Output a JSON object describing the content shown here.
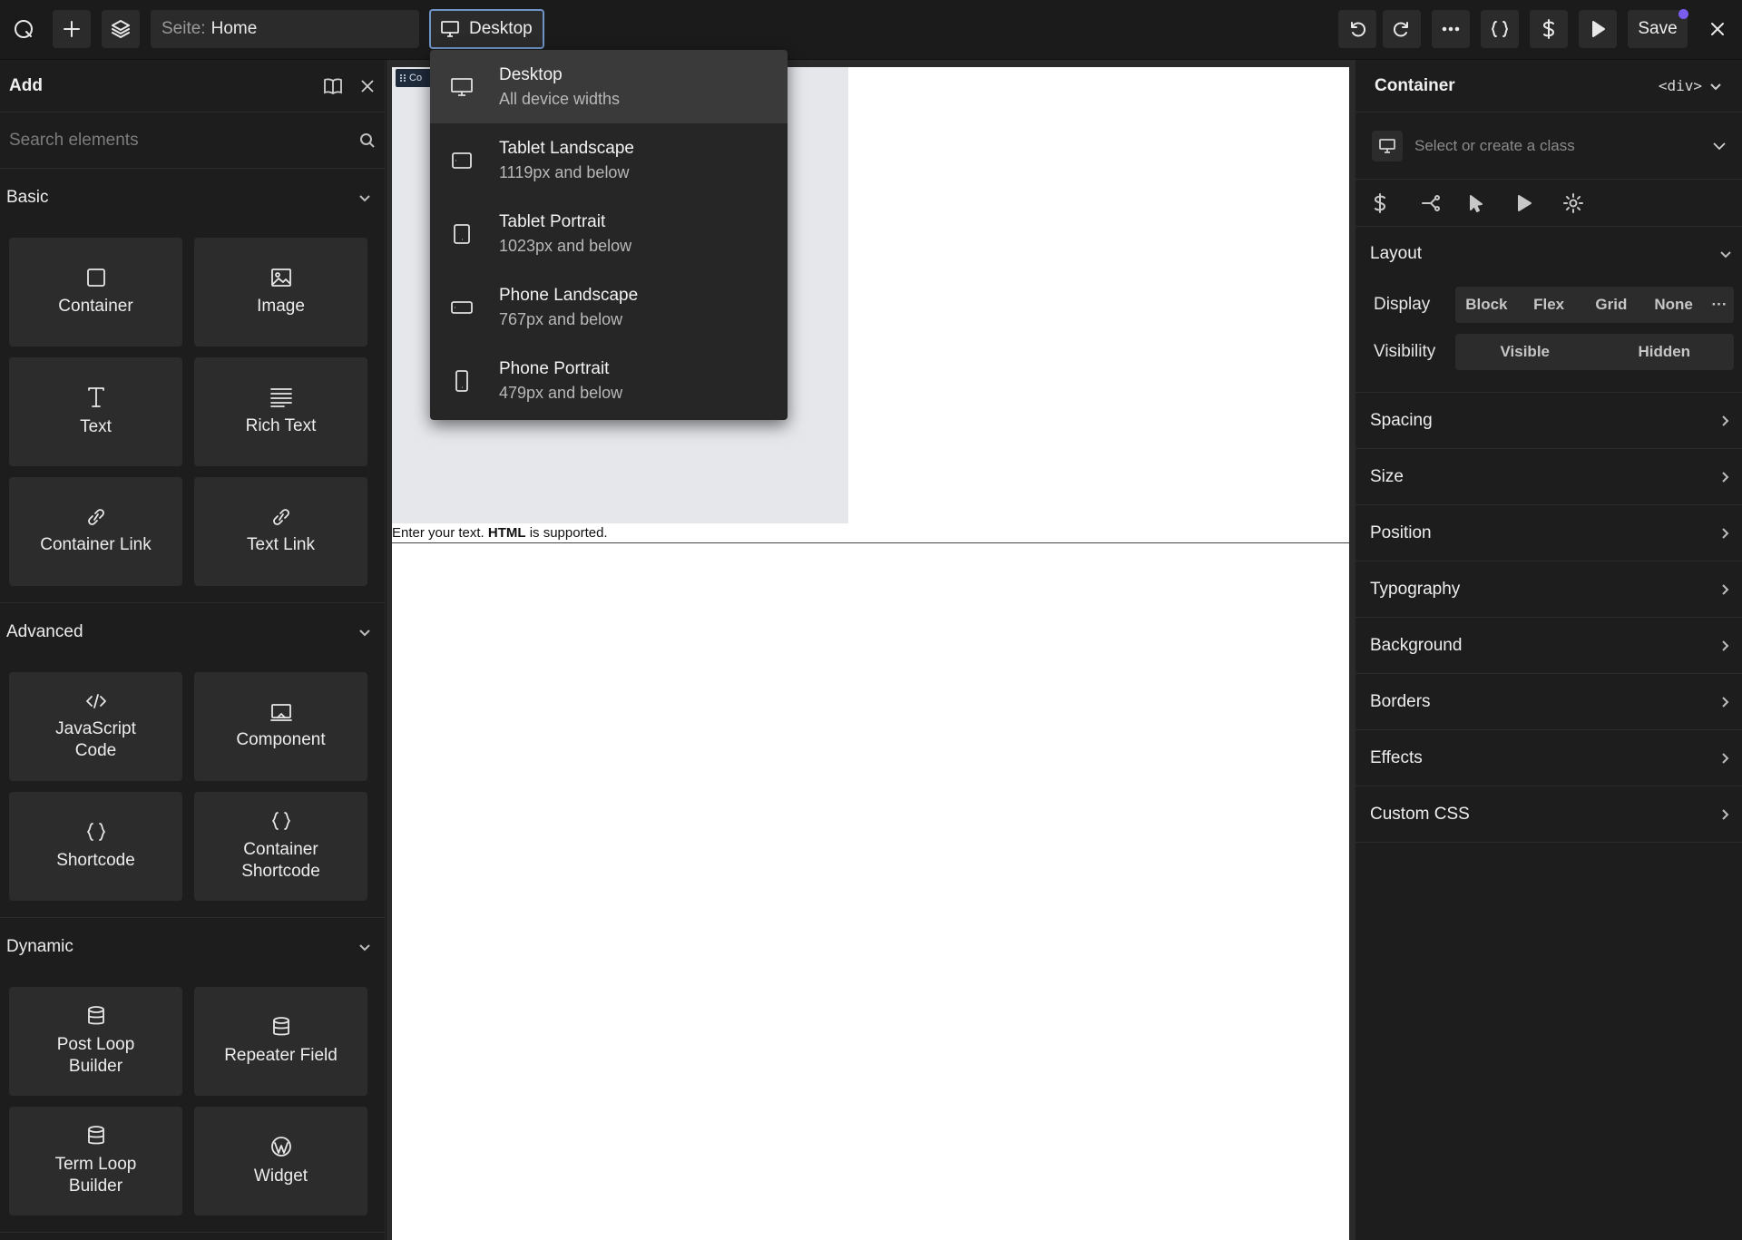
{
  "toolbar": {
    "page_prefix": "Seite:",
    "page_value": "Home",
    "device_label": "Desktop",
    "save_label": "Save"
  },
  "add_panel": {
    "title": "Add",
    "search_placeholder": "Search elements",
    "sections": [
      {
        "name": "Basic",
        "items": [
          "Container",
          "Image",
          "Text",
          "Rich Text",
          "Container Link",
          "Text Link"
        ]
      },
      {
        "name": "Advanced",
        "items": [
          "JavaScript Code",
          "Component",
          "Shortcode",
          "Container Shortcode"
        ]
      },
      {
        "name": "Dynamic",
        "items": [
          "Post Loop Builder",
          "Repeater Field",
          "Term Loop Builder",
          "Widget"
        ]
      }
    ]
  },
  "canvas": {
    "selected_tag": "Co",
    "text_before": "Enter your text. ",
    "text_bold": "HTML",
    "text_after": " is supported."
  },
  "breakpoints": [
    {
      "name": "Desktop",
      "desc": "All device widths",
      "icon": "desktop-icon"
    },
    {
      "name": "Tablet Landscape",
      "desc": "1119px and below",
      "icon": "tablet-landscape-icon"
    },
    {
      "name": "Tablet Portrait",
      "desc": "1023px and below",
      "icon": "tablet-portrait-icon"
    },
    {
      "name": "Phone Landscape",
      "desc": "767px and below",
      "icon": "phone-landscape-icon"
    },
    {
      "name": "Phone Portrait",
      "desc": "479px and below",
      "icon": "phone-portrait-icon"
    }
  ],
  "inspector": {
    "title": "Container",
    "tag": "<div>",
    "class_placeholder": "Select or create a class",
    "layout_title": "Layout",
    "display_label": "Display",
    "display_options": [
      "Block",
      "Flex",
      "Grid",
      "None"
    ],
    "display_more": "···",
    "visibility_label": "Visibility",
    "visibility_options": [
      "Visible",
      "Hidden"
    ],
    "sections": [
      "Spacing",
      "Size",
      "Position",
      "Typography",
      "Background",
      "Borders",
      "Effects",
      "Custom CSS"
    ]
  },
  "colors": {
    "accent_border": "#6f94c8",
    "save_dot": "#7a5cf0",
    "canvas_box": "#e5e7eb"
  }
}
